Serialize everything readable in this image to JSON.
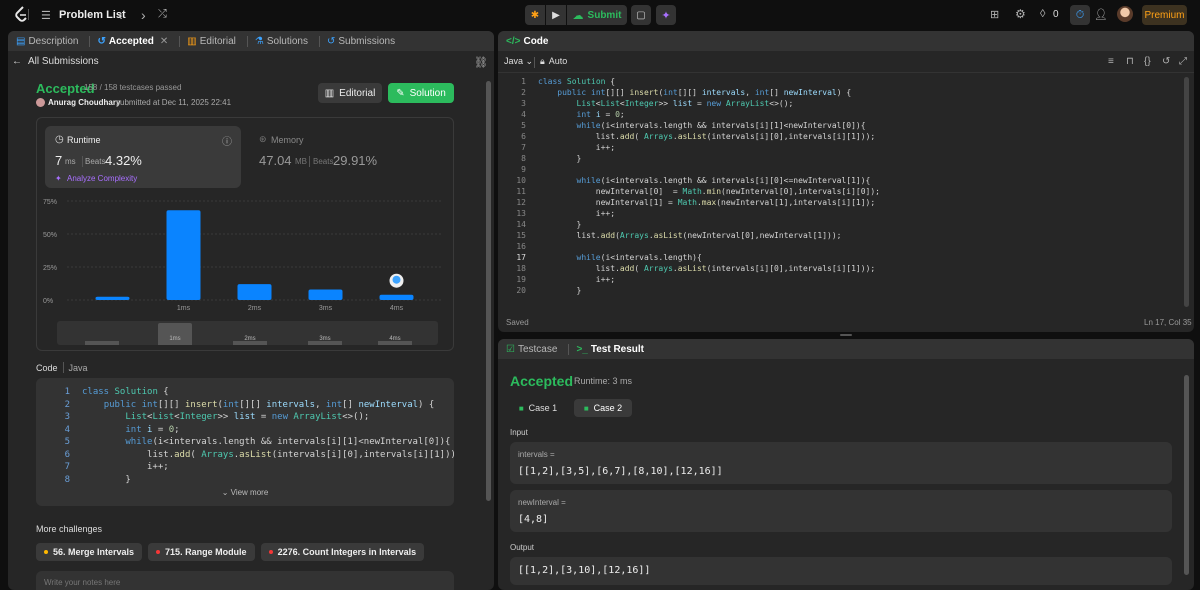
{
  "topnav": {
    "problem_list": "Problem List",
    "submit": "Submit",
    "streak": "0",
    "premium": "Premium"
  },
  "left": {
    "tabs": {
      "description": "Description",
      "accepted": "Accepted",
      "editorial": "Editorial",
      "solutions": "Solutions",
      "submissions": "Submissions"
    },
    "all_submissions": "All Submissions",
    "status": "Accepted",
    "testcases": "158 / 158 testcases passed",
    "user": "Anurag Choudhary",
    "submitted": "submitted at Dec 11, 2025 22:41",
    "editorial_btn": "Editorial",
    "solution_btn": "Solution",
    "runtime": {
      "label": "Runtime",
      "value": "7",
      "unit": "ms",
      "beats_label": "Beats",
      "beats": "4.32%",
      "analyze": "Analyze Complexity"
    },
    "memory": {
      "label": "Memory",
      "value": "47.04",
      "unit": "MB",
      "beats_label": "Beats",
      "beats": "29.91%"
    },
    "code_label": "Code",
    "lang": "Java",
    "view_more": "View more",
    "more_challenges": "More challenges",
    "challenges": [
      {
        "label": "56. Merge Intervals",
        "color": "#ffb800"
      },
      {
        "label": "715. Range Module",
        "color": "#f63737"
      },
      {
        "label": "2276. Count Integers in Intervals",
        "color": "#f63737"
      }
    ],
    "notes_placeholder": "Write your notes here"
  },
  "chart_data": {
    "type": "bar",
    "categories": [
      "",
      "1ms",
      "2ms",
      "3ms",
      "4ms"
    ],
    "values": [
      2.5,
      68,
      12,
      8,
      4
    ],
    "ylim": [
      0,
      75
    ],
    "yticks": [
      "75%",
      "50%",
      "25%",
      "0%"
    ],
    "highlight": "4ms",
    "nav_labels": [
      "1ms",
      "2ms",
      "3ms",
      "4ms"
    ]
  },
  "editor": {
    "title": "Code",
    "lang": "Java",
    "auto": "Auto",
    "saved": "Saved",
    "cursor": "Ln 17, Col 35"
  },
  "result": {
    "tab_testcase": "Testcase",
    "tab_result": "Test Result",
    "status": "Accepted",
    "runtime": "Runtime: 3 ms",
    "case1": "Case 1",
    "case2": "Case 2",
    "input": "Input",
    "var1": "intervals =",
    "val1": "[[1,2],[3,5],[6,7],[8,10],[12,16]]",
    "var2": "newInterval =",
    "val2": "[4,8]",
    "output": "Output",
    "out": "[[1,2],[3,10],[12,16]]"
  },
  "code_html": [
    "<span class='kw'>class</span> <span class='ty'>Solution</span> {",
    "    <span class='kw'>public</span> <span class='kw'>int</span>[][] <span class='fn'>insert</span>(<span class='kw'>int</span>[][] <span class='vr'>intervals</span>, <span class='kw'>int</span>[] <span class='vr'>newInterval</span>) {",
    "        <span class='ty'>List</span>&lt;<span class='ty'>List</span>&lt;<span class='ty'>Integer</span>&gt;&gt; <span class='vr'>list</span> = <span class='kw'>new</span> <span class='ty'>ArrayList</span>&lt;&gt;();",
    "        <span class='kw'>int</span> <span class='vr'>i</span> = <span class='nm'>0</span>;",
    "        <span class='kw'>while</span>(i&lt;intervals.length &amp;&amp; intervals[i][1]&lt;newInterval[0]){",
    "            list.<span class='fn'>add</span>( <span class='ty'>Arrays</span>.<span class='fn'>asList</span>(intervals[i][0],intervals[i][1]));",
    "            i++;",
    "        }",
    "",
    "        <span class='kw'>while</span>(i&lt;intervals.length &amp;&amp; intervals[i][0]&lt;=newInterval[1]){",
    "            newInterval[0]  = <span class='ty'>Math</span>.<span class='fn'>min</span>(newInterval[0],intervals[i][0]);",
    "            newInterval[1] = <span class='ty'>Math</span>.<span class='fn'>max</span>(newInterval[1],intervals[i][1]);",
    "            i++;",
    "        }",
    "        list.<span class='fn'>add</span>(<span class='ty'>Arrays</span>.<span class='fn'>asList</span>(newInterval[0],newInterval[1]));",
    "",
    "        <span class='kw'>while</span>(i&lt;intervals.length){",
    "            list.<span class='fn'>add</span>( <span class='ty'>Arrays</span>.<span class='fn'>asList</span>(intervals[i][0],intervals[i][1]));",
    "            i++;",
    "        }"
  ]
}
